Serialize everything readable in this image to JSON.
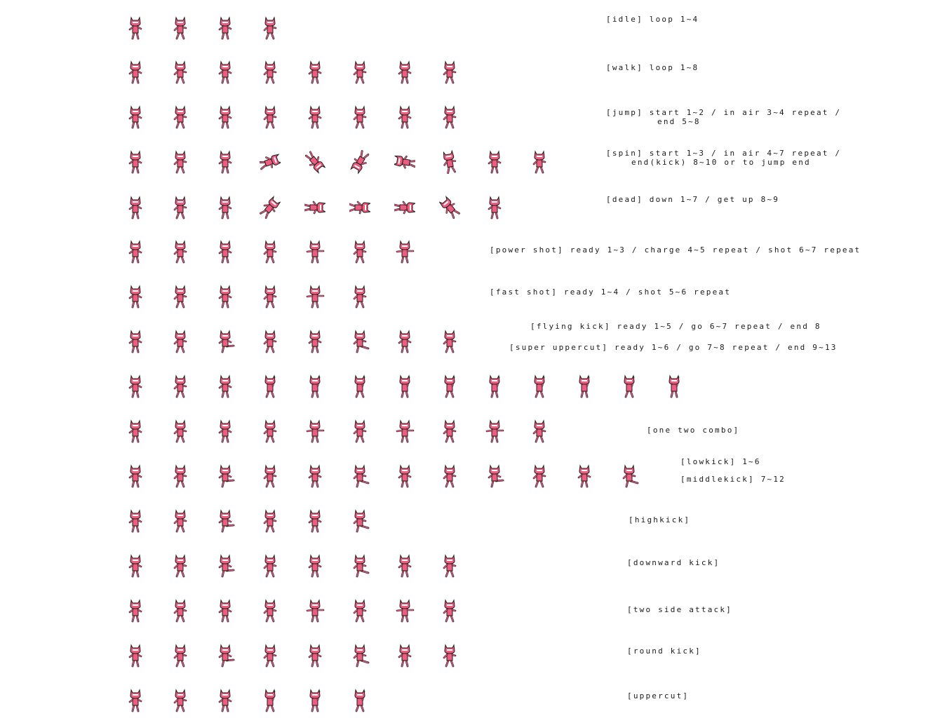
{
  "sheet": {
    "title": "",
    "colors": {
      "body": "#ee5d80",
      "outline": "#1b1b1b",
      "eyes": "#ffffff",
      "background": "#ffffff"
    },
    "rows": [
      {
        "frames": 4,
        "pose": "stand",
        "labels": [
          "[idle] loop 1~4"
        ]
      },
      {
        "frames": 8,
        "pose": "walk",
        "labels": [
          "[walk] loop 1~8"
        ]
      },
      {
        "frames": 8,
        "pose": "jump",
        "labels": [
          "[jump] start 1~2 / in air 3~4 repeat /",
          "end 5~8"
        ]
      },
      {
        "frames": 10,
        "pose": "spin",
        "labels": [
          "[spin] start 1~3 / in air 4~7 repeat /",
          "end(kick) 8~10 or to jump end"
        ]
      },
      {
        "frames": 9,
        "pose": "dead",
        "labels": [
          "[dead] down 1~7 / get up 8~9"
        ]
      },
      {
        "frames": 7,
        "pose": "shot",
        "labels": [
          "[power shot] ready 1~3 / charge 4~5 repeat / shot 6~7 repeat"
        ]
      },
      {
        "frames": 6,
        "pose": "shot",
        "labels": [
          "[fast shot] ready 1~4 / shot 5~6 repeat"
        ]
      },
      {
        "frames": 8,
        "pose": "kick",
        "labels": [
          "[flying kick] ready 1~5 / go 6~7 repeat / end 8"
        ]
      },
      {
        "frames": 13,
        "pose": "rise",
        "labels": [
          "[super uppercut] ready 1~6 / go 7~8 repeat / end 9~13"
        ]
      },
      {
        "frames": 10,
        "pose": "punch",
        "labels": [
          "[one two combo]"
        ]
      },
      {
        "frames": 12,
        "pose": "kick",
        "labels": [
          "[lowkick] 1~6",
          "[middlekick] 7~12"
        ]
      },
      {
        "frames": 6,
        "pose": "kick",
        "labels": [
          "[highkick]"
        ]
      },
      {
        "frames": 8,
        "pose": "kick",
        "labels": [
          "[downward kick]"
        ]
      },
      {
        "frames": 8,
        "pose": "punch",
        "labels": [
          "[two side attack]"
        ]
      },
      {
        "frames": 8,
        "pose": "kick",
        "labels": [
          "[round kick]"
        ]
      },
      {
        "frames": 6,
        "pose": "rise",
        "labels": [
          "[uppercut]"
        ]
      }
    ]
  }
}
